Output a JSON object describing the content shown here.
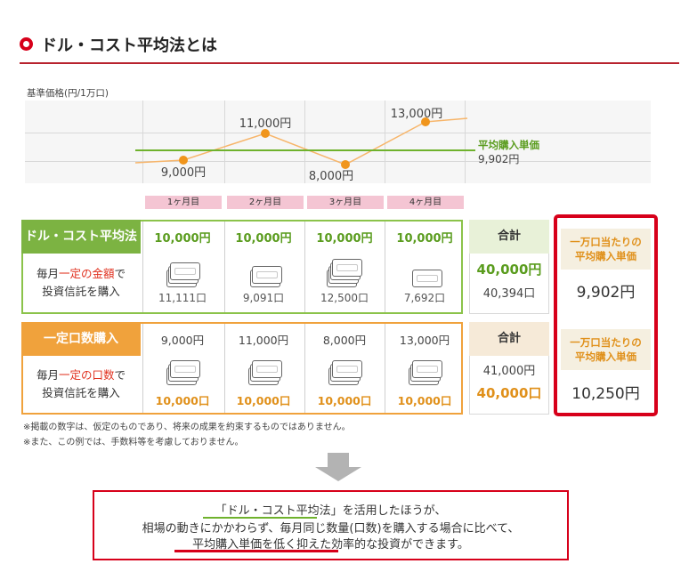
{
  "header": {
    "title": "ドル・コスト平均法とは"
  },
  "chart": {
    "y_axis_label": "基準価格(円/1万口)",
    "points": [
      "9,000円",
      "11,000円",
      "8,000円",
      "13,000円"
    ],
    "avg_label": "平均購入単価",
    "avg_value": "9,902円",
    "months": [
      "1ヶ月目",
      "2ヶ月目",
      "3ヶ月目",
      "4ヶ月目"
    ]
  },
  "chart_data": {
    "type": "line",
    "categories": [
      "1ヶ月目",
      "2ヶ月目",
      "3ヶ月目",
      "4ヶ月目"
    ],
    "values": [
      9000,
      11000,
      8000,
      13000
    ],
    "reference_line": 9902,
    "ylabel": "基準価格(円/1万口)"
  },
  "dca": {
    "name": "ドル・コスト平均法",
    "desc_line1_pre": "毎月",
    "desc_line1_red": "一定の金額",
    "desc_line1_post": "で",
    "desc_line2": "投資信託を購入",
    "amounts": [
      "10,000円",
      "10,000円",
      "10,000円",
      "10,000円"
    ],
    "units": [
      "11,111口",
      "9,091口",
      "12,500口",
      "7,692口"
    ],
    "bill_counts": [
      3,
      2,
      4,
      1
    ],
    "total_label": "合計",
    "total_amount": "40,000円",
    "total_units": "40,394口"
  },
  "fixed": {
    "name": "一定口数購入",
    "desc_line1_pre": "毎月",
    "desc_line1_red": "一定の口数",
    "desc_line1_post": "で",
    "desc_line2": "投資信託を購入",
    "amounts": [
      "9,000円",
      "11,000円",
      "8,000円",
      "13,000円"
    ],
    "units": [
      "10,000口",
      "10,000口",
      "10,000口",
      "10,000口"
    ],
    "bill_counts": [
      3,
      3,
      3,
      3
    ],
    "total_label": "合計",
    "total_amount": "41,000円",
    "total_units": "40,000口"
  },
  "per_unit": {
    "head_line1": "一万口当たりの",
    "head_line2": "平均購入単価",
    "dca_value": "9,902円",
    "fixed_value": "10,250円"
  },
  "notes": [
    "※掲載の数字は、仮定のものであり、将来の成果を約束するものではありません。",
    "※また、この例では、手数料等を考慮しておりません。"
  ],
  "conclusion": {
    "line1": "「ドル・コスト平均法」を活用したほうが、",
    "line2": "相場の動きにかかわらず、毎月同じ数量(口数)を購入する場合に比べて、",
    "line3": "平均購入単価を低く抑えた効率的な投資ができます。"
  },
  "colors": {
    "accent_red": "#d7001a",
    "green": "#7cb342",
    "orange": "#f0a23c",
    "dot_orange": "#f0951c"
  }
}
